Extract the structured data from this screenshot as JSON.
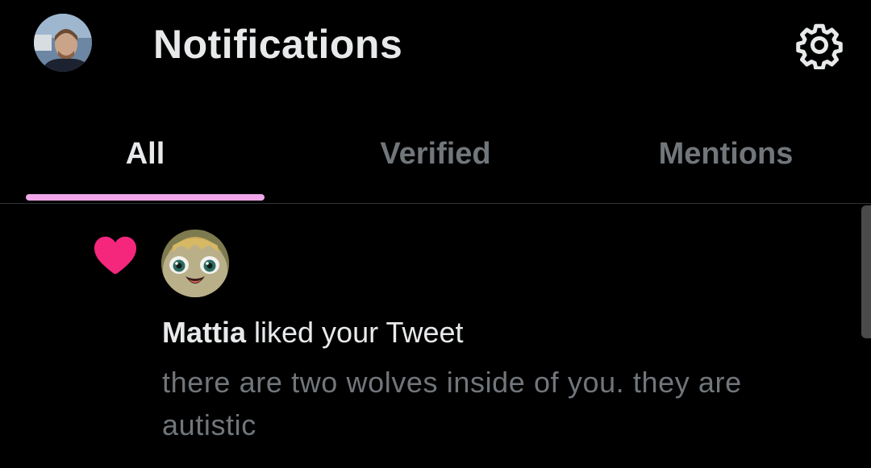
{
  "header": {
    "title": "Notifications",
    "profile_avatar_icon": "user-photo-avatar",
    "settings_icon": "gear-icon"
  },
  "tabs": [
    {
      "label": "All",
      "active": true
    },
    {
      "label": "Verified",
      "active": false
    },
    {
      "label": "Mentions",
      "active": false
    }
  ],
  "notifications": [
    {
      "type": "like",
      "icon": "heart-icon",
      "user_name": "Mattia",
      "action_text": " liked your Tweet",
      "tweet_text": "there are two wolves inside of you. they are autistic"
    }
  ],
  "colors": {
    "background": "#000000",
    "primary_text": "#e7e9ea",
    "secondary_text": "#71767b",
    "tab_indicator": "#f0a6ea",
    "heart": "#f4277c",
    "divider": "#2f3336"
  }
}
